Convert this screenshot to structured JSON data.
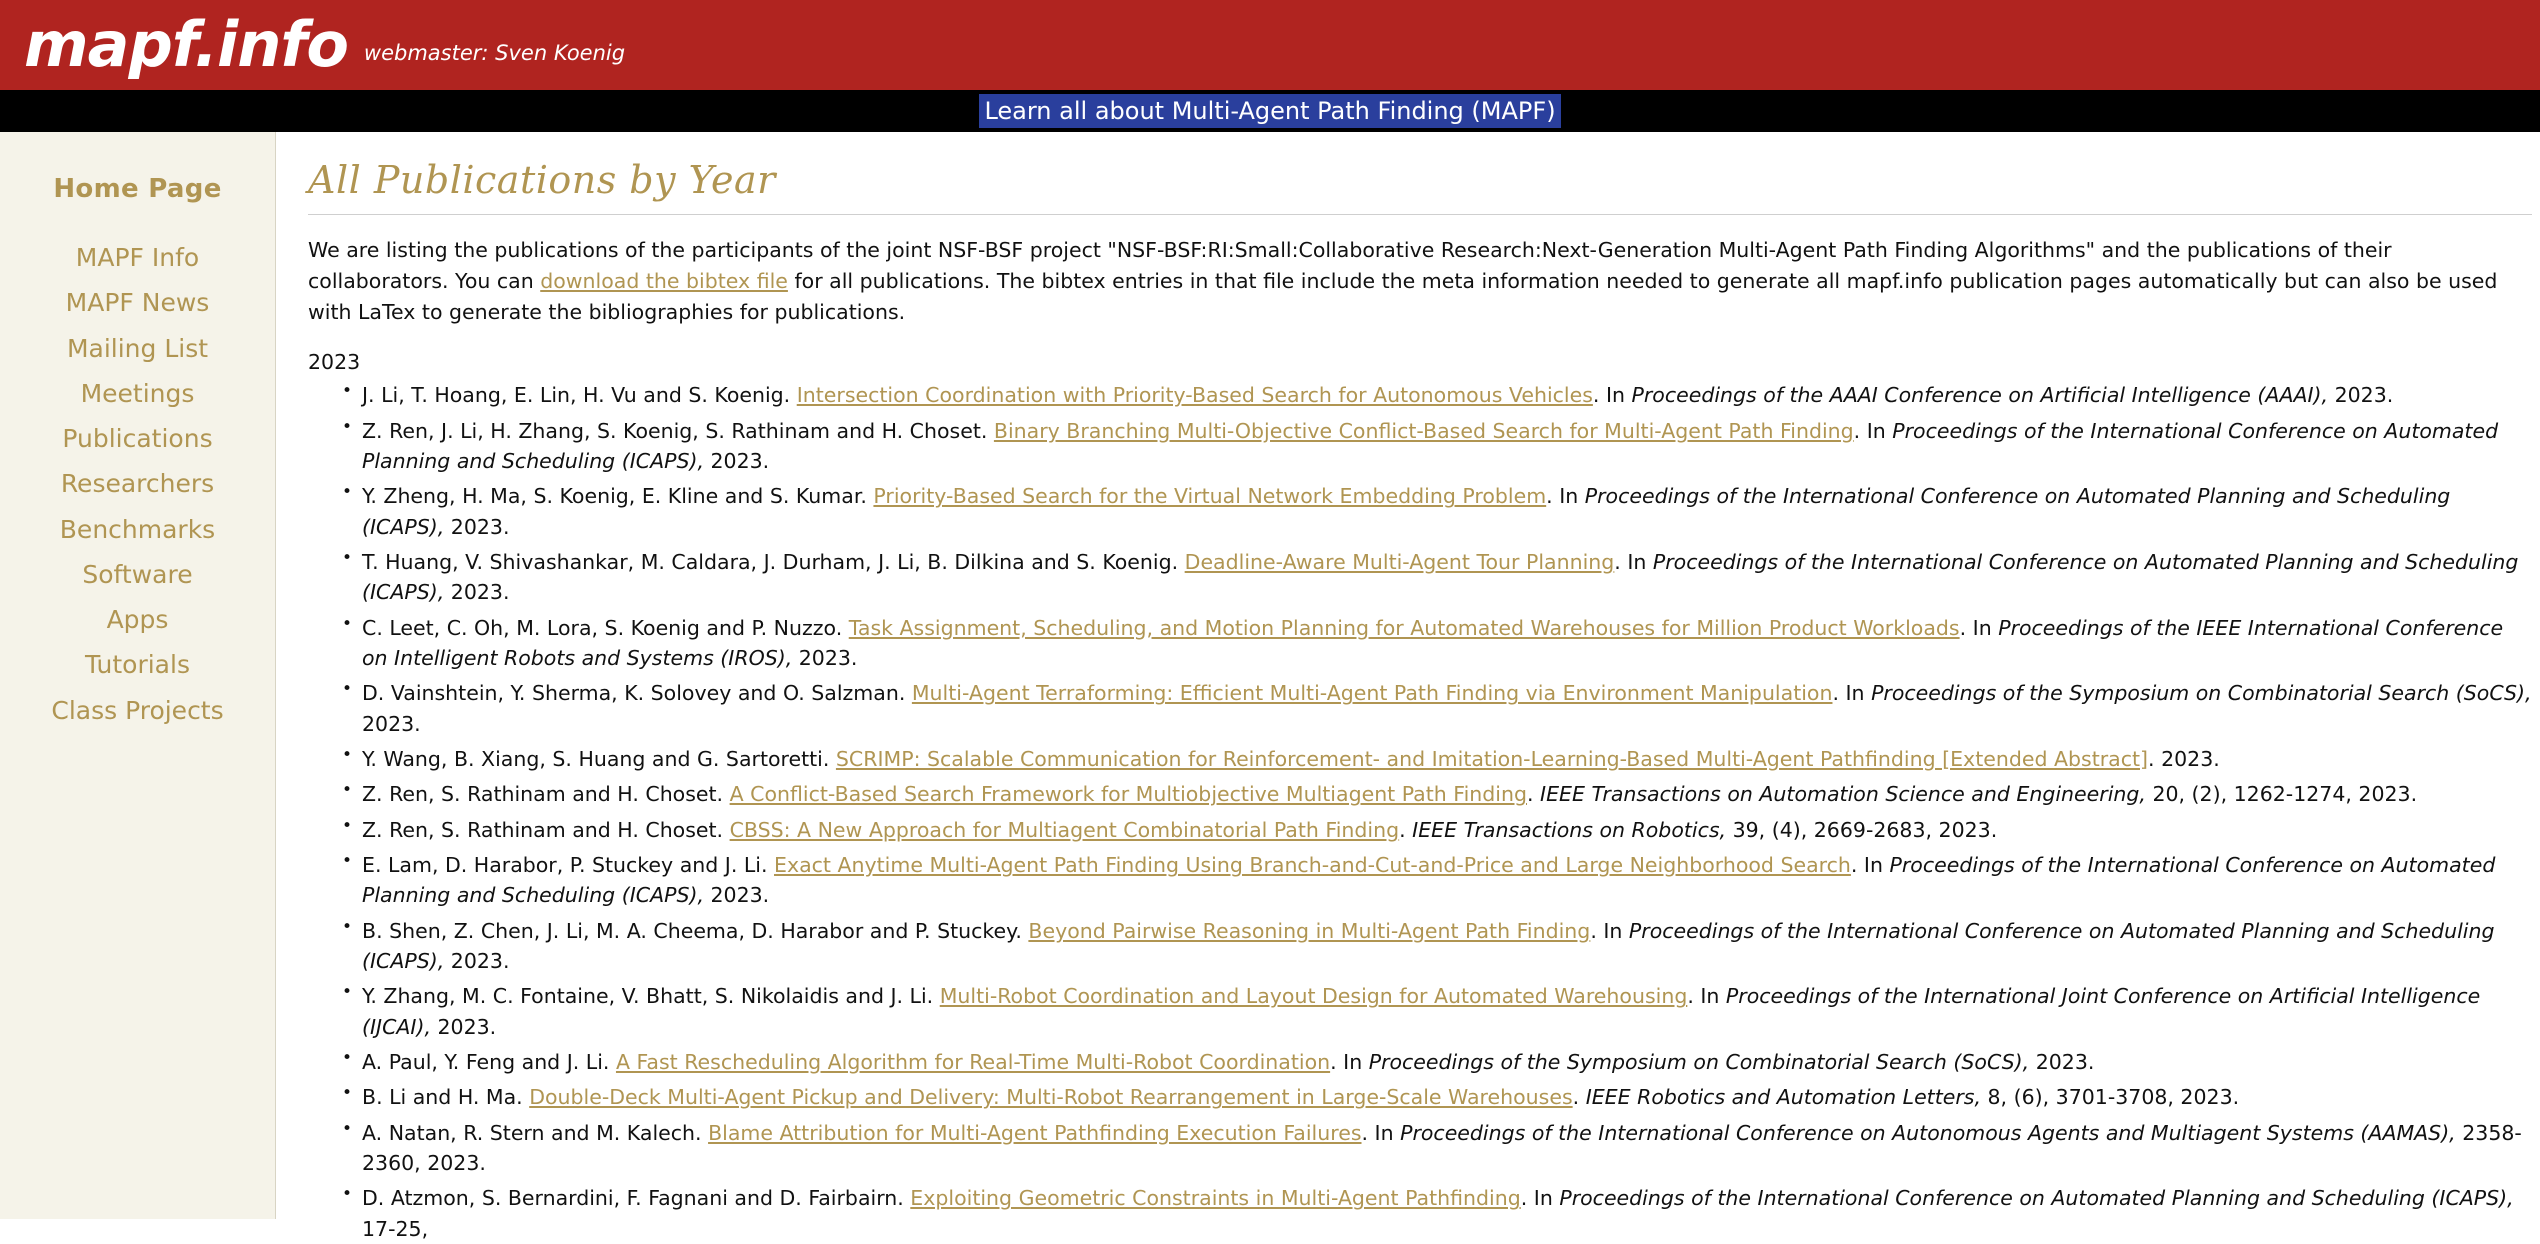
{
  "header": {
    "logo": "mapf.info",
    "webmaster": "webmaster: Sven Koenig",
    "banner_bg": "#b02420"
  },
  "nav": {
    "link_label": "Learn all about Multi-Agent Path Finding (MAPF)",
    "highlight_color": "#2a3f9d"
  },
  "sidebar": {
    "home_label": "Home Page",
    "accent_color": "#b09552",
    "background": "#f5f3e9",
    "items": [
      {
        "label": "MAPF Info"
      },
      {
        "label": "MAPF News"
      },
      {
        "label": "Mailing List"
      },
      {
        "label": "Meetings"
      },
      {
        "label": "Publications"
      },
      {
        "label": "Researchers"
      },
      {
        "label": "Benchmarks"
      },
      {
        "label": "Software"
      },
      {
        "label": "Apps"
      },
      {
        "label": "Tutorials"
      },
      {
        "label": "Class Projects"
      }
    ]
  },
  "main": {
    "title": "All Publications by Year",
    "intro_part1": "We are listing the publications of the participants of the joint NSF-BSF project \"NSF-BSF:RI:Small:Collaborative Research:Next-Generation Multi-Agent Path Finding Algorithms\" and the publications of their collaborators. You can ",
    "intro_link": "download the bibtex file",
    "intro_part2": " for all publications. The bibtex entries in that file include the meta information needed to generate all mapf.info publication pages automatically but can also be used with LaTex to generate the bibliographies for publications.",
    "year": "2023",
    "publications": [
      {
        "authors": "J. Li, T. Hoang, E. Lin, H. Vu and S. Koenig.",
        "title": "Intersection Coordination with Priority-Based Search for Autonomous Vehicles",
        "venue_prefix": ". In ",
        "venue": "Proceedings of the AAAI Conference on Artificial Intelligence (AAAI),",
        "suffix": " 2023."
      },
      {
        "authors": "Z. Ren, J. Li, H. Zhang, S. Koenig, S. Rathinam and H. Choset.",
        "title": "Binary Branching Multi-Objective Conflict-Based Search for Multi-Agent Path Finding",
        "venue_prefix": ". In ",
        "venue": "Proceedings of the International Conference on Automated Planning and Scheduling (ICAPS),",
        "suffix": " 2023."
      },
      {
        "authors": "Y. Zheng, H. Ma, S. Koenig, E. Kline and S. Kumar.",
        "title": "Priority-Based Search for the Virtual Network Embedding Problem",
        "venue_prefix": ". In ",
        "venue": "Proceedings of the International Conference on Automated Planning and Scheduling (ICAPS),",
        "suffix": " 2023."
      },
      {
        "authors": "T. Huang, V. Shivashankar, M. Caldara, J. Durham, J. Li, B. Dilkina and S. Koenig.",
        "title": "Deadline-Aware Multi-Agent Tour Planning",
        "venue_prefix": ". In ",
        "venue": "Proceedings of the International Conference on Automated Planning and Scheduling (ICAPS),",
        "suffix": " 2023."
      },
      {
        "authors": "C. Leet, C. Oh, M. Lora, S. Koenig and P. Nuzzo.",
        "title": "Task Assignment, Scheduling, and Motion Planning for Automated Warehouses for Million Product Workloads",
        "venue_prefix": ". In ",
        "venue": "Proceedings of the IEEE International Conference on Intelligent Robots and Systems (IROS),",
        "suffix": " 2023."
      },
      {
        "authors": "D. Vainshtein, Y. Sherma, K. Solovey and O. Salzman.",
        "title": "Multi-Agent Terraforming: Efficient Multi-Agent Path Finding via Environment Manipulation",
        "venue_prefix": ". In ",
        "venue": "Proceedings of the Symposium on Combinatorial Search (SoCS),",
        "suffix": " 2023."
      },
      {
        "authors": "Y. Wang, B. Xiang, S. Huang and G. Sartoretti.",
        "title": "SCRIMP: Scalable Communication for Reinforcement- and Imitation-Learning-Based Multi-Agent Pathfinding [Extended Abstract]",
        "venue_prefix": ". ",
        "venue": "",
        "suffix": "2023."
      },
      {
        "authors": "Z. Ren, S. Rathinam and H. Choset.",
        "title": "A Conflict-Based Search Framework for Multiobjective Multiagent Path Finding",
        "venue_prefix": ". ",
        "venue": "IEEE Transactions on Automation Science and Engineering,",
        "suffix": " 20, (2), 1262-1274, 2023."
      },
      {
        "authors": "Z. Ren, S. Rathinam and H. Choset.",
        "title": "CBSS: A New Approach for Multiagent Combinatorial Path Finding",
        "venue_prefix": ". ",
        "venue": "IEEE Transactions on Robotics,",
        "suffix": " 39, (4), 2669-2683, 2023."
      },
      {
        "authors": "E. Lam, D. Harabor, P. Stuckey and J. Li.",
        "title": "Exact Anytime Multi-Agent Path Finding Using Branch-and-Cut-and-Price and Large Neighborhood Search",
        "venue_prefix": ". In ",
        "venue": "Proceedings of the International Conference on Automated Planning and Scheduling (ICAPS),",
        "suffix": " 2023."
      },
      {
        "authors": "B. Shen, Z. Chen, J. Li, M. A. Cheema, D. Harabor and P. Stuckey.",
        "title": "Beyond Pairwise Reasoning in Multi-Agent Path Finding",
        "venue_prefix": ". In ",
        "venue": "Proceedings of the International Conference on Automated Planning and Scheduling (ICAPS),",
        "suffix": " 2023."
      },
      {
        "authors": "Y. Zhang, M. C. Fontaine, V. Bhatt, S. Nikolaidis and J. Li.",
        "title": "Multi-Robot Coordination and Layout Design for Automated Warehousing",
        "venue_prefix": ". In ",
        "venue": "Proceedings of the International Joint Conference on Artificial Intelligence (IJCAI),",
        "suffix": " 2023."
      },
      {
        "authors": "A. Paul, Y. Feng and J. Li.",
        "title": "A Fast Rescheduling Algorithm for Real-Time Multi-Robot Coordination",
        "venue_prefix": ". In ",
        "venue": "Proceedings of the Symposium on Combinatorial Search (SoCS),",
        "suffix": " 2023."
      },
      {
        "authors": "B. Li and H. Ma.",
        "title": "Double-Deck Multi-Agent Pickup and Delivery: Multi-Robot Rearrangement in Large-Scale Warehouses",
        "venue_prefix": ". ",
        "venue": "IEEE Robotics and Automation Letters,",
        "suffix": " 8, (6), 3701-3708, 2023."
      },
      {
        "authors": "A. Natan, R. Stern and M. Kalech.",
        "title": "Blame Attribution for Multi-Agent Pathfinding Execution Failures",
        "venue_prefix": ". In ",
        "venue": "Proceedings of the International Conference on Autonomous Agents and Multiagent Systems (AAMAS),",
        "suffix": " 2358-2360, 2023."
      },
      {
        "authors": "D. Atzmon, S. Bernardini, F. Fagnani and D. Fairbairn.",
        "title": "Exploiting Geometric Constraints in Multi-Agent Pathfinding",
        "venue_prefix": ". In ",
        "venue": "Proceedings of the International Conference on Automated Planning and Scheduling (ICAPS),",
        "suffix": " 17-25,"
      }
    ]
  }
}
